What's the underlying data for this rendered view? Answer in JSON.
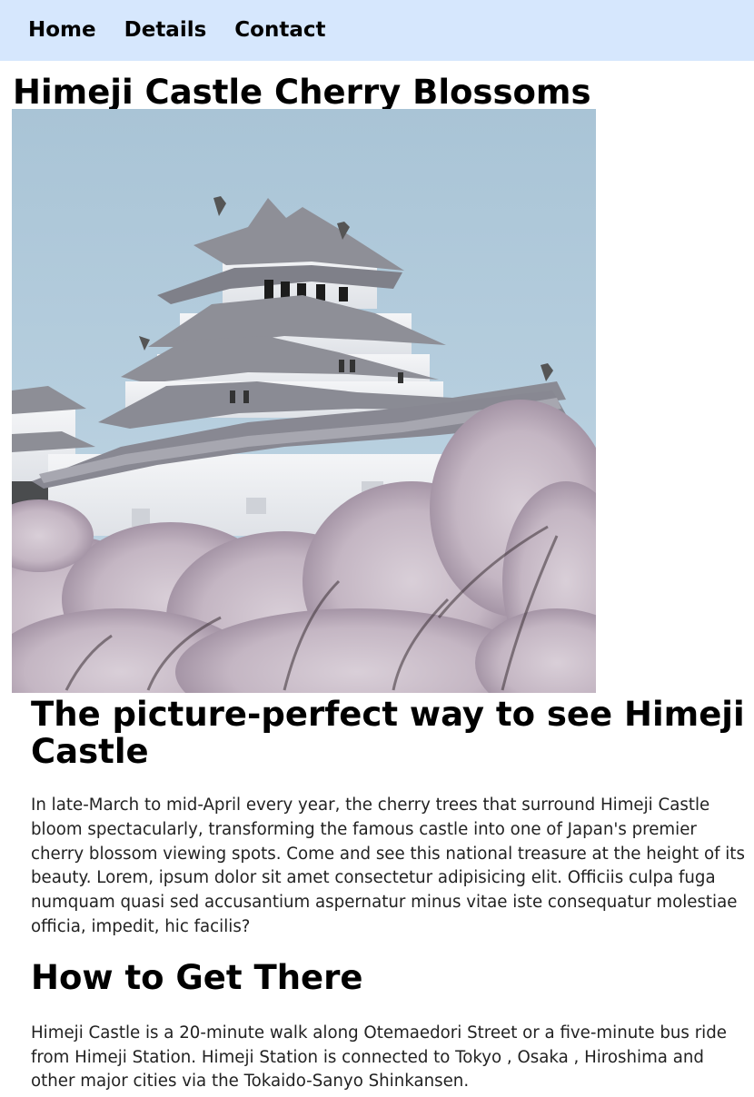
{
  "nav": {
    "items": [
      {
        "label": "Home"
      },
      {
        "label": "Details"
      },
      {
        "label": "Contact"
      }
    ]
  },
  "page": {
    "title": "Himeji Castle Cherry Blossoms"
  },
  "hero": {
    "image_subject": "Himeji Castle behind blooming cherry trees",
    "colors": {
      "sky": "#aec9dc",
      "blossom": "#cfc2ce",
      "castle": "#eef0f3",
      "roof": "#8f8f98"
    }
  },
  "main": {
    "heading": "The picture-perfect way to see Himeji Castle",
    "intro": "In late-March to mid-April every year, the cherry trees that surround Himeji Castle bloom spectacularly, transforming the famous castle into one of Japan's premier cherry blossom viewing spots. Come and see this national treasure at the height of its beauty. Lorem, ipsum dolor sit amet consectetur adipisicing elit. Officiis culpa fuga numquam quasi sed accusantium aspernatur minus vitae iste consequatur molestiae officia, impedit, hic facilis?",
    "directions_heading": "How to Get There",
    "directions": "Himeji Castle is a 20-minute walk along Otemaedori Street or a five-minute bus ride from Himeji Station. Himeji Station is connected to Tokyo , Osaka , Hiroshima and other major cities via the Tokaido-Sanyo Shinkansen."
  }
}
